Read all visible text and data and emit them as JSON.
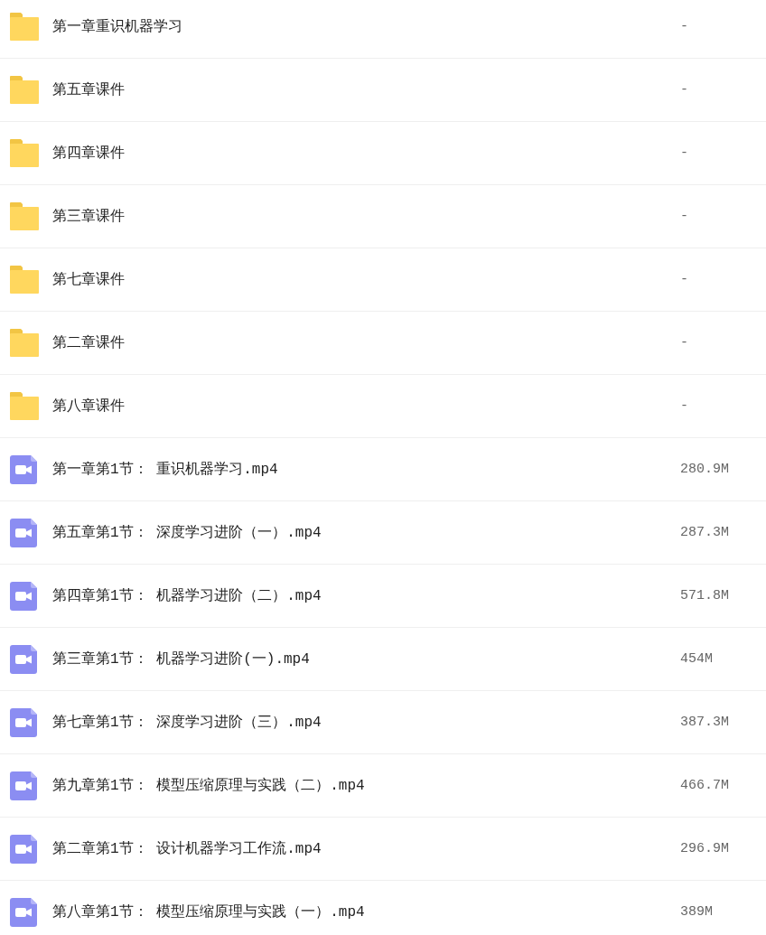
{
  "items": [
    {
      "kind": "folder",
      "name": "第一章重识机器学习",
      "size": "-"
    },
    {
      "kind": "folder",
      "name": "第五章课件",
      "size": "-"
    },
    {
      "kind": "folder",
      "name": "第四章课件",
      "size": "-"
    },
    {
      "kind": "folder",
      "name": "第三章课件",
      "size": "-"
    },
    {
      "kind": "folder",
      "name": "第七章课件",
      "size": "-"
    },
    {
      "kind": "folder",
      "name": "第二章课件",
      "size": "-"
    },
    {
      "kind": "folder",
      "name": "第八章课件",
      "size": "-"
    },
    {
      "kind": "video",
      "name": "第一章第1节： 重识机器学习.mp4",
      "size": "280.9M"
    },
    {
      "kind": "video",
      "name": "第五章第1节： 深度学习进阶（一）.mp4",
      "size": "287.3M"
    },
    {
      "kind": "video",
      "name": "第四章第1节： 机器学习进阶（二）.mp4",
      "size": "571.8M"
    },
    {
      "kind": "video",
      "name": "第三章第1节： 机器学习进阶(一).mp4",
      "size": "454M"
    },
    {
      "kind": "video",
      "name": "第七章第1节： 深度学习进阶（三）.mp4",
      "size": "387.3M"
    },
    {
      "kind": "video",
      "name": "第九章第1节： 模型压缩原理与实践（二）.mp4",
      "size": "466.7M"
    },
    {
      "kind": "video",
      "name": "第二章第1节： 设计机器学习工作流.mp4",
      "size": "296.9M"
    },
    {
      "kind": "video",
      "name": "第八章第1节： 模型压缩原理与实践（一）.mp4",
      "size": "389M"
    }
  ]
}
